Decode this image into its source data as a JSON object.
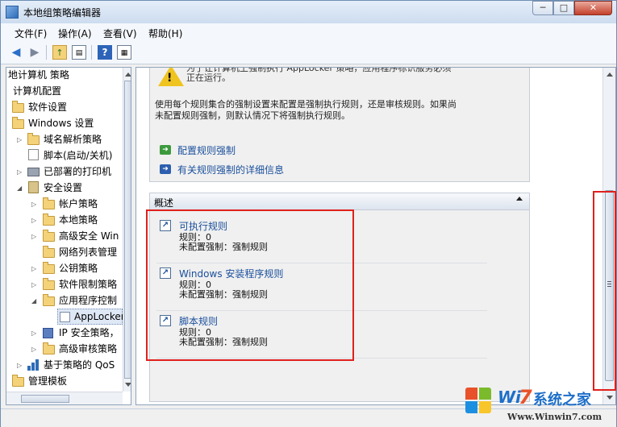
{
  "window": {
    "title": "本地组策略编辑器"
  },
  "caption_buttons": {
    "minimize": "─",
    "maximize": "□",
    "close": "✕"
  },
  "menu": [
    "文件(F)",
    "操作(A)",
    "查看(V)",
    "帮助(H)"
  ],
  "toolbar_icons": [
    "back-icon",
    "forward-icon",
    "up-folder-icon",
    "show-tree-icon",
    "help-icon",
    "properties-icon"
  ],
  "tree": {
    "items": [
      {
        "label": "地计算机 策略"
      },
      {
        "label": "计算机配置"
      },
      {
        "label": "软件设置"
      },
      {
        "label": "Windows 设置"
      },
      {
        "label": "域名解析策略"
      },
      {
        "label": "脚本(启动/关机)"
      },
      {
        "label": "已部署的打印机"
      },
      {
        "label": "安全设置"
      },
      {
        "label": "帐户策略"
      },
      {
        "label": "本地策略"
      },
      {
        "label": "高级安全 Win"
      },
      {
        "label": "网络列表管理"
      },
      {
        "label": "公钥策略"
      },
      {
        "label": "软件限制策略"
      },
      {
        "label": "应用程序控制"
      },
      {
        "label": "AppLocker"
      },
      {
        "label": "IP 安全策略，"
      },
      {
        "label": "高级审核策略"
      },
      {
        "label": "基于策略的 QoS"
      },
      {
        "label": "管理模板"
      }
    ]
  },
  "content": {
    "warning_lines": [
      "为了让计算机上强制执行 AppLocker 策略，应用程序标识服务必须",
      "正在运行。"
    ],
    "description_lines": [
      "使用每个规则集合的强制设置来配置是强制执行规则，还是审核规则。如果尚",
      "未配置规则强制，则默认情况下将强制执行规则。"
    ],
    "links": [
      "配置规则强制",
      "有关规则强制的详细信息"
    ],
    "overview": {
      "title": "概述",
      "rules": [
        {
          "title": "可执行规则",
          "count": "规则：0",
          "enforcement": "未配置强制：强制规则"
        },
        {
          "title": "Windows 安装程序规则",
          "count": "规则：0",
          "enforcement": "未配置强制：强制规则"
        },
        {
          "title": "脚本规则",
          "count": "规则：0",
          "enforcement": "未配置强制：强制规则"
        }
      ]
    }
  },
  "watermark": {
    "brand_prefix": "Wi",
    "brand_7": "7",
    "brand_cn": "系统之家",
    "url": "Www.Winwin7.com"
  },
  "colors": {
    "highlight": "#e0201c",
    "link": "#1a4f9c",
    "warning": "#f0c420"
  }
}
